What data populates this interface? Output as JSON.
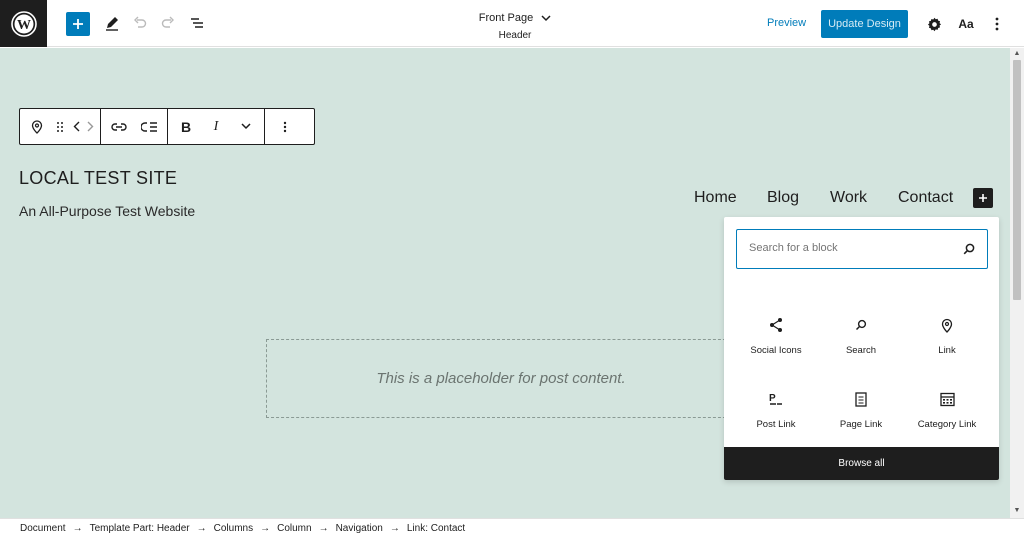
{
  "header": {
    "doc_title": "Front Page",
    "doc_subtitle": "Header",
    "preview_label": "Preview",
    "update_label": "Update Design",
    "styles_label": "Aa"
  },
  "toolbar": {
    "bold": "B",
    "italic": "I"
  },
  "site": {
    "title": "LOCAL TEST SITE",
    "tagline": "An All-Purpose Test Website"
  },
  "nav": {
    "items": [
      "Home",
      "Blog",
      "Work",
      "Contact"
    ]
  },
  "content": {
    "placeholder": "This is a placeholder for post content."
  },
  "inserter": {
    "search_placeholder": "Search for a block",
    "blocks": [
      {
        "label": "Social Icons",
        "icon": "share-icon"
      },
      {
        "label": "Search",
        "icon": "search-icon"
      },
      {
        "label": "Link",
        "icon": "location-pin-icon"
      },
      {
        "label": "Post Link",
        "icon": "post-link-icon"
      },
      {
        "label": "Page Link",
        "icon": "page-icon"
      },
      {
        "label": "Category Link",
        "icon": "calendar-icon"
      }
    ],
    "browse_all": "Browse all"
  },
  "breadcrumb": [
    "Document",
    "Template Part: Header",
    "Columns",
    "Column",
    "Navigation",
    "Link: Contact"
  ],
  "colors": {
    "accent": "#007cba",
    "canvas_bg": "#d3e4de",
    "dark": "#1e1e1e"
  }
}
